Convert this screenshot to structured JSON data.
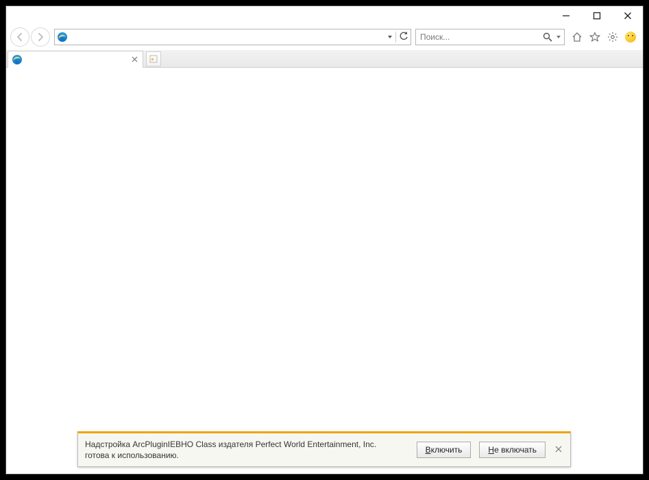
{
  "search": {
    "placeholder": "Поиск..."
  },
  "tab": {
    "title": ""
  },
  "addressbar": {
    "value": ""
  },
  "notification": {
    "line1": "Надстройка ArcPluginIEBHO Class издателя Perfect World Entertainment, Inc.",
    "line2": "готова к использованию.",
    "enable_underline": "В",
    "enable_rest": "ключить",
    "disable_underline": "Н",
    "disable_rest": "е включать"
  }
}
